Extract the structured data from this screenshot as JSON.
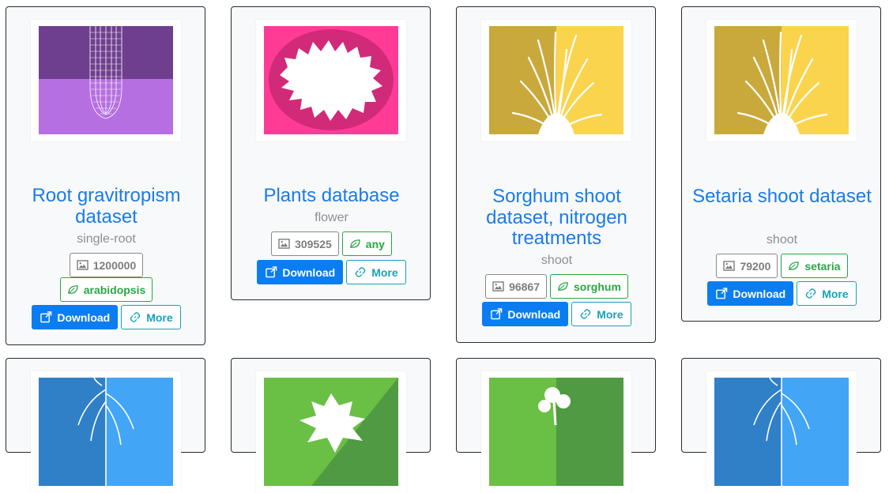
{
  "cards": [
    {
      "title": "Root gravitropism dataset",
      "subtitle": "single-root",
      "image_count": "1200000",
      "crop": "arabidopsis",
      "download_label": "Download",
      "more_label": "More",
      "thumbnail": "root-gravitropism-thumbnail",
      "colors": {
        "top": "#6f3f8f",
        "bottom": "#b56fe0"
      }
    },
    {
      "title": "Plants database",
      "subtitle": "flower",
      "image_count": "309525",
      "crop": "any",
      "download_label": "Download",
      "more_label": "More",
      "thumbnail": "flower-thumbnail",
      "colors": {
        "bg": "#ff3b96",
        "ellipse": "#d12a79"
      }
    },
    {
      "title": "Sorghum shoot dataset, nitrogen treatments",
      "subtitle": "shoot",
      "image_count": "96867",
      "crop": "sorghum",
      "download_label": "Download",
      "more_label": "More",
      "thumbnail": "grass-shoot-thumbnail",
      "colors": {
        "left": "#c9a93c",
        "right": "#fbd44e"
      }
    },
    {
      "title": "Setaria shoot dataset",
      "subtitle": "shoot",
      "image_count": "79200",
      "crop": "setaria",
      "download_label": "Download",
      "more_label": "More",
      "thumbnail": "grass-shoot-thumbnail",
      "colors": {
        "left": "#c9a93c",
        "right": "#fbd44e"
      }
    }
  ],
  "lower_cards": [
    {
      "thumbnail": "root-system-thumbnail",
      "colors": {
        "left": "#2f80c7",
        "right": "#42a5f5"
      }
    },
    {
      "thumbnail": "leaf-thumbnail",
      "colors": {
        "left": "#6abf45",
        "right": "#4f9a42"
      }
    },
    {
      "thumbnail": "seedling-thumbnail",
      "colors": {
        "left": "#6abf45",
        "right": "#4f9a42"
      }
    },
    {
      "thumbnail": "root-system-thumbnail",
      "colors": {
        "left": "#2f80c7",
        "right": "#42a5f5"
      }
    }
  ],
  "icons": {
    "image_count": "image-icon",
    "crop": "leaf-icon",
    "download": "external-link-icon",
    "more": "link-icon"
  }
}
